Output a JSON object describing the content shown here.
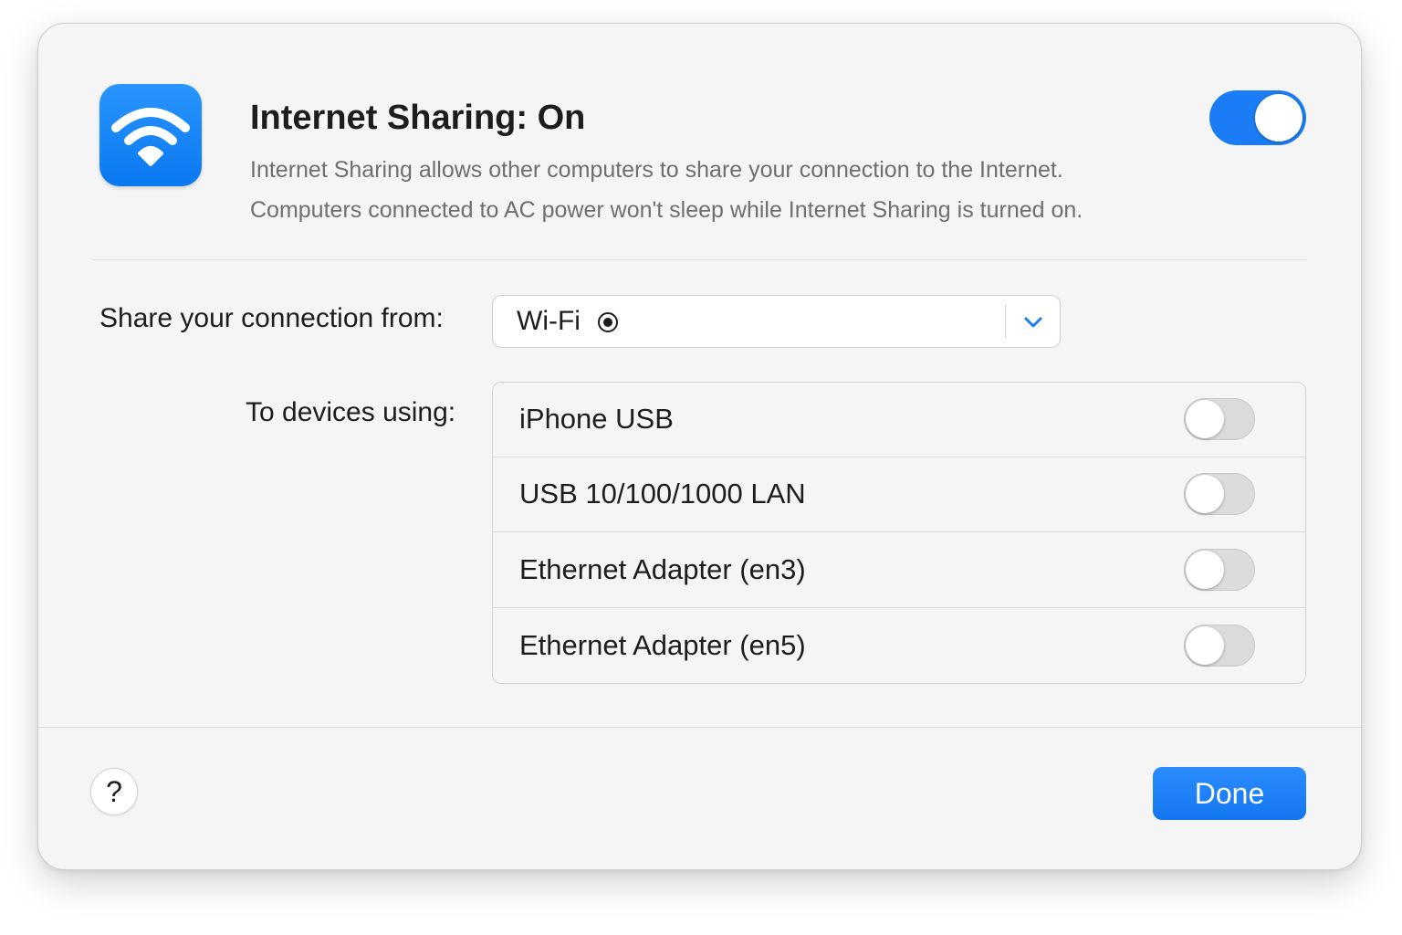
{
  "header": {
    "icon": "wifi-icon",
    "title": "Internet Sharing: On",
    "description_line1": "Internet Sharing allows other computers to share your connection to the Internet.",
    "description_line2": "Computers connected to AC power won't sleep while Internet Sharing is turned on.",
    "enabled": true
  },
  "share_from": {
    "label": "Share your connection from:",
    "selected": "Wi-Fi",
    "selected_icon": "radio-dot-icon",
    "dropdown_icon": "chevron-down-icon"
  },
  "to_devices": {
    "label": "To devices using:",
    "items": [
      {
        "label": "iPhone USB",
        "enabled": false
      },
      {
        "label": "USB 10/100/1000 LAN",
        "enabled": false
      },
      {
        "label": "Ethernet Adapter (en3)",
        "enabled": false
      },
      {
        "label": "Ethernet Adapter (en5)",
        "enabled": false
      }
    ]
  },
  "footer": {
    "help_label": "?",
    "done_label": "Done"
  },
  "colors": {
    "accent": "#1a7df5",
    "background": "#f5f5f5",
    "toggle_off": "#dcdcdc"
  }
}
